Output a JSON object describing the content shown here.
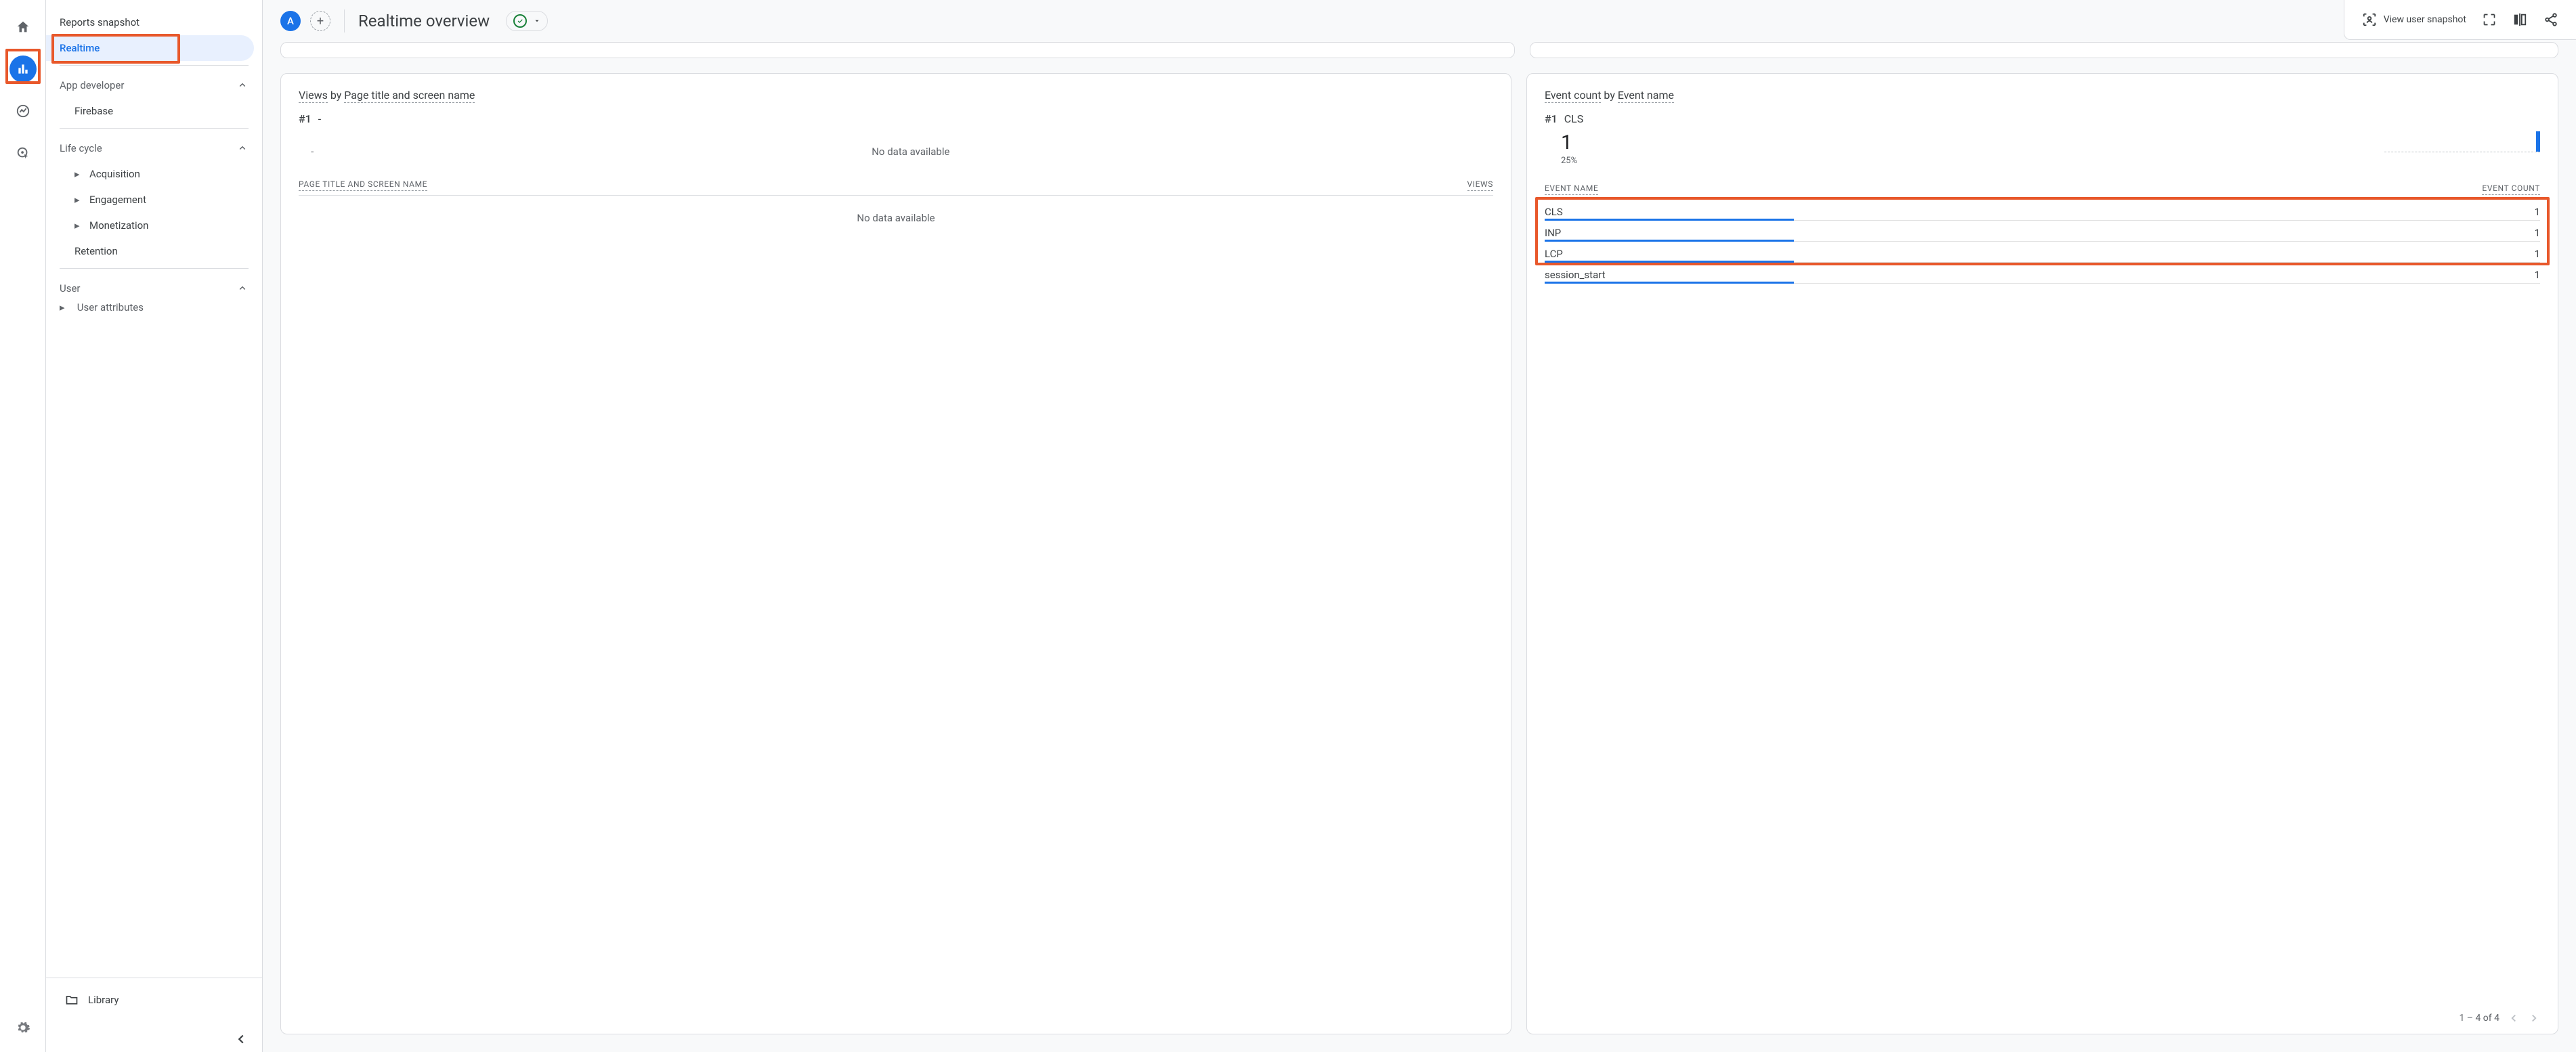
{
  "rail": {
    "items": [
      "home",
      "reports",
      "explore",
      "advertising"
    ]
  },
  "sidebar": {
    "reports_snapshot": "Reports snapshot",
    "realtime": "Realtime",
    "sections": {
      "app_developer": {
        "label": "App developer",
        "items": [
          "Firebase"
        ]
      },
      "life_cycle": {
        "label": "Life cycle",
        "items": [
          "Acquisition",
          "Engagement",
          "Monetization",
          "Retention"
        ]
      },
      "user": {
        "label": "User",
        "items": [
          "User attributes"
        ]
      }
    },
    "library": "Library"
  },
  "header": {
    "avatar_initial": "A",
    "title": "Realtime overview",
    "actions": {
      "view_snapshot": "View user snapshot"
    }
  },
  "cards": {
    "views": {
      "title_prefix": "Views",
      "title_by": " by ",
      "title_dim": "Page title and screen name",
      "rank": "#1",
      "rank_value": "-",
      "nodata": "No data available",
      "col_left": "PAGE TITLE AND SCREEN NAME",
      "col_right": "VIEWS",
      "nodata_table": "No data available"
    },
    "events": {
      "title_prefix": "Event count",
      "title_by": " by ",
      "title_dim": "Event name",
      "rank": "#1",
      "rank_value": "CLS",
      "big_value": "1",
      "pct": "25%",
      "col_left": "EVENT NAME",
      "col_right": "EVENT COUNT",
      "rows": [
        {
          "name": "CLS",
          "count": "1",
          "bar_pct": 25
        },
        {
          "name": "INP",
          "count": "1",
          "bar_pct": 25
        },
        {
          "name": "LCP",
          "count": "1",
          "bar_pct": 25
        },
        {
          "name": "session_start",
          "count": "1",
          "bar_pct": 25
        }
      ],
      "pager": "1 – 4 of 4"
    }
  },
  "chart_data": {
    "type": "bar",
    "title": "Event count by Event name",
    "xlabel": "Event name",
    "ylabel": "Event count",
    "categories": [
      "CLS",
      "INP",
      "LCP",
      "session_start"
    ],
    "values": [
      1,
      1,
      1,
      1
    ],
    "ylim": [
      0,
      1
    ]
  }
}
